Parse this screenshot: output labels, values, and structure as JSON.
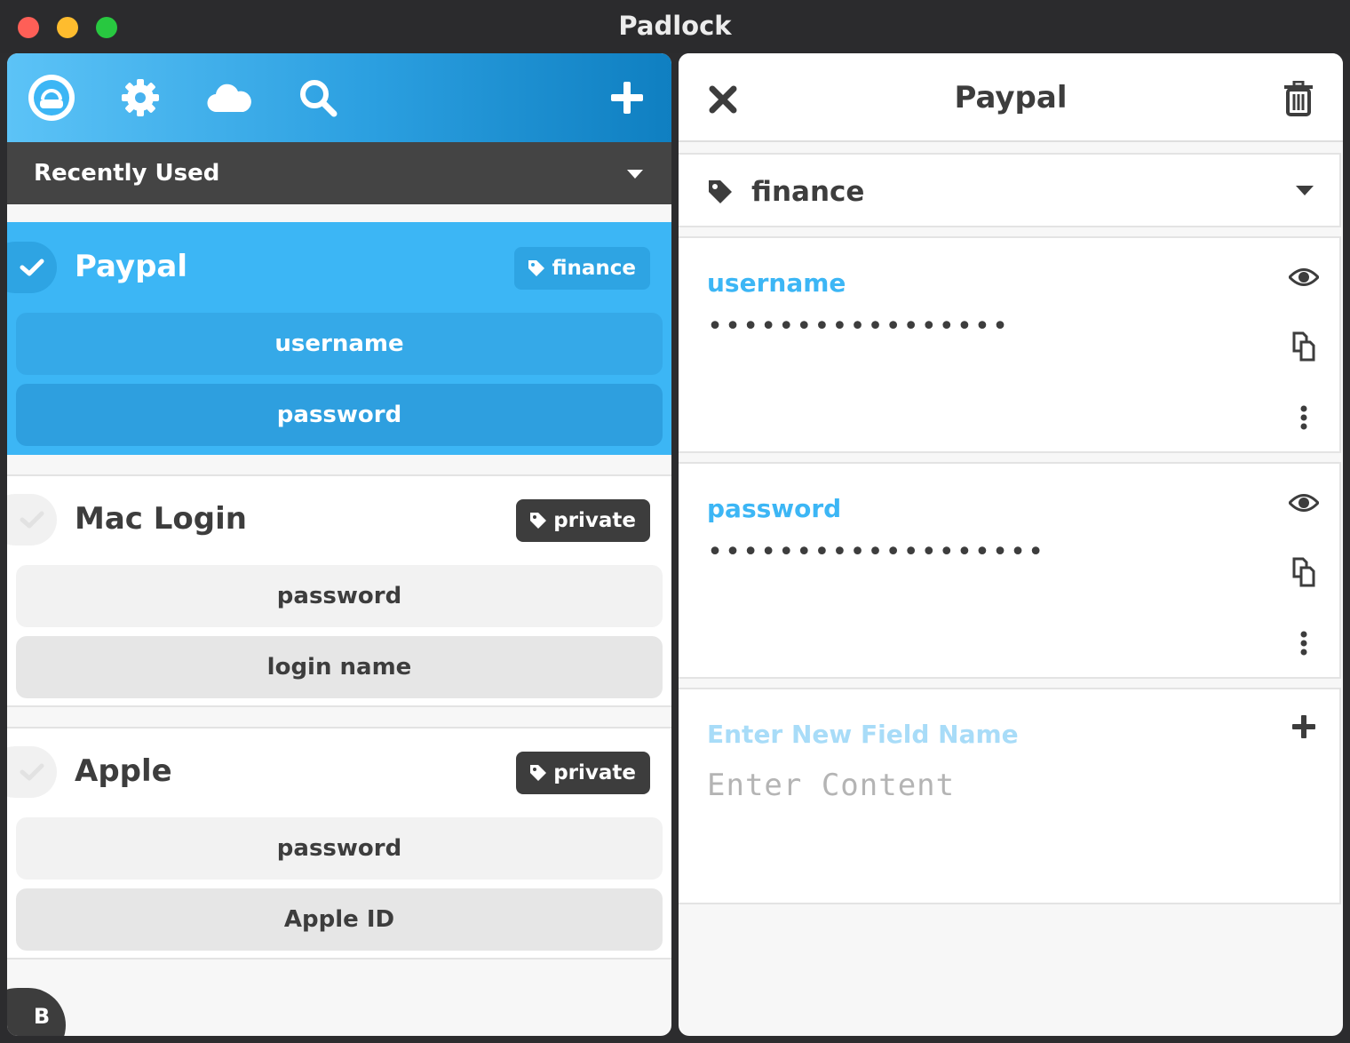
{
  "window": {
    "title": "Padlock"
  },
  "toolbar": {
    "icons": [
      "padlock-logo-icon",
      "gear-icon",
      "cloud-icon",
      "search-icon",
      "plus-icon"
    ]
  },
  "filter": {
    "label": "Recently Used"
  },
  "records": [
    {
      "name": "Paypal",
      "tag": "finance",
      "selected": true,
      "fields": [
        "username",
        "password"
      ]
    },
    {
      "name": "Mac Login",
      "tag": "private",
      "selected": false,
      "fields": [
        "password",
        "login name"
      ]
    },
    {
      "name": "Apple",
      "tag": "private",
      "selected": false,
      "fields": [
        "password",
        "Apple ID"
      ]
    }
  ],
  "badge": {
    "label": "B"
  },
  "detail": {
    "title": "Paypal",
    "tag": "finance",
    "fields": [
      {
        "name": "username",
        "value": "•••••••••••••••••"
      },
      {
        "name": "password",
        "value": "•••••••••••••••••••"
      }
    ],
    "new_field": {
      "name_placeholder": "Enter New Field Name",
      "content_placeholder": "Enter Content"
    }
  },
  "colors": {
    "accent": "#3cb6f5",
    "dark": "#3d3d3d",
    "filter_bar": "#444444"
  }
}
